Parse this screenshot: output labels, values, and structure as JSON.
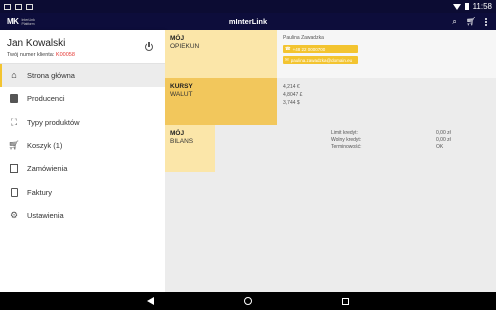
{
  "status_bar": {
    "time": "11:58"
  },
  "app_bar": {
    "logo_mark": "MK",
    "logo_text": "InterLink Platform",
    "title": "mInterLink",
    "actions": [
      "search-icon",
      "cart-icon",
      "more-vert-icon"
    ]
  },
  "drawer": {
    "user_name": "Jan Kowalski",
    "client_label": "Twój numer klienta:",
    "client_number": "K00058",
    "items": [
      {
        "label": "Strona główna",
        "icon": "home-icon",
        "active": true
      },
      {
        "label": "Producenci",
        "icon": "producer-icon"
      },
      {
        "label": "Typy produktów",
        "icon": "product-types-icon"
      },
      {
        "label": "Koszyk (1)",
        "icon": "cart-icon"
      },
      {
        "label": "Zamówienia",
        "icon": "orders-icon"
      },
      {
        "label": "Faktury",
        "icon": "invoice-icon"
      },
      {
        "label": "Ustawienia",
        "icon": "settings-icon"
      }
    ]
  },
  "dashboard": {
    "advisor": {
      "title_line1": "MÓJ",
      "title_line2": "OPIEKUN",
      "name": "Paulina Zawadzka",
      "phone": "+48 22 0000700",
      "email": "paulina.zawadzka@domain.eu"
    },
    "rates": {
      "title_line1": "KURSY",
      "title_line2": "WALUT",
      "values": [
        "4,214 €",
        "4,8047 £",
        "3,744 $"
      ]
    },
    "balance": {
      "title_line1": "MÓJ",
      "title_line2": "BILANS",
      "rows": [
        {
          "label": "Limit kredyt:",
          "value": "0,00 zł"
        },
        {
          "label": "Wolny kredyt:",
          "value": "0,00 zł"
        },
        {
          "label": "Terminowość:",
          "value": "OK"
        }
      ]
    }
  },
  "colors": {
    "accent": "#f3c430",
    "appbar": "#0d0d3b",
    "light_yellow": "#fbe6a9",
    "mid_yellow": "#f2c75c"
  }
}
